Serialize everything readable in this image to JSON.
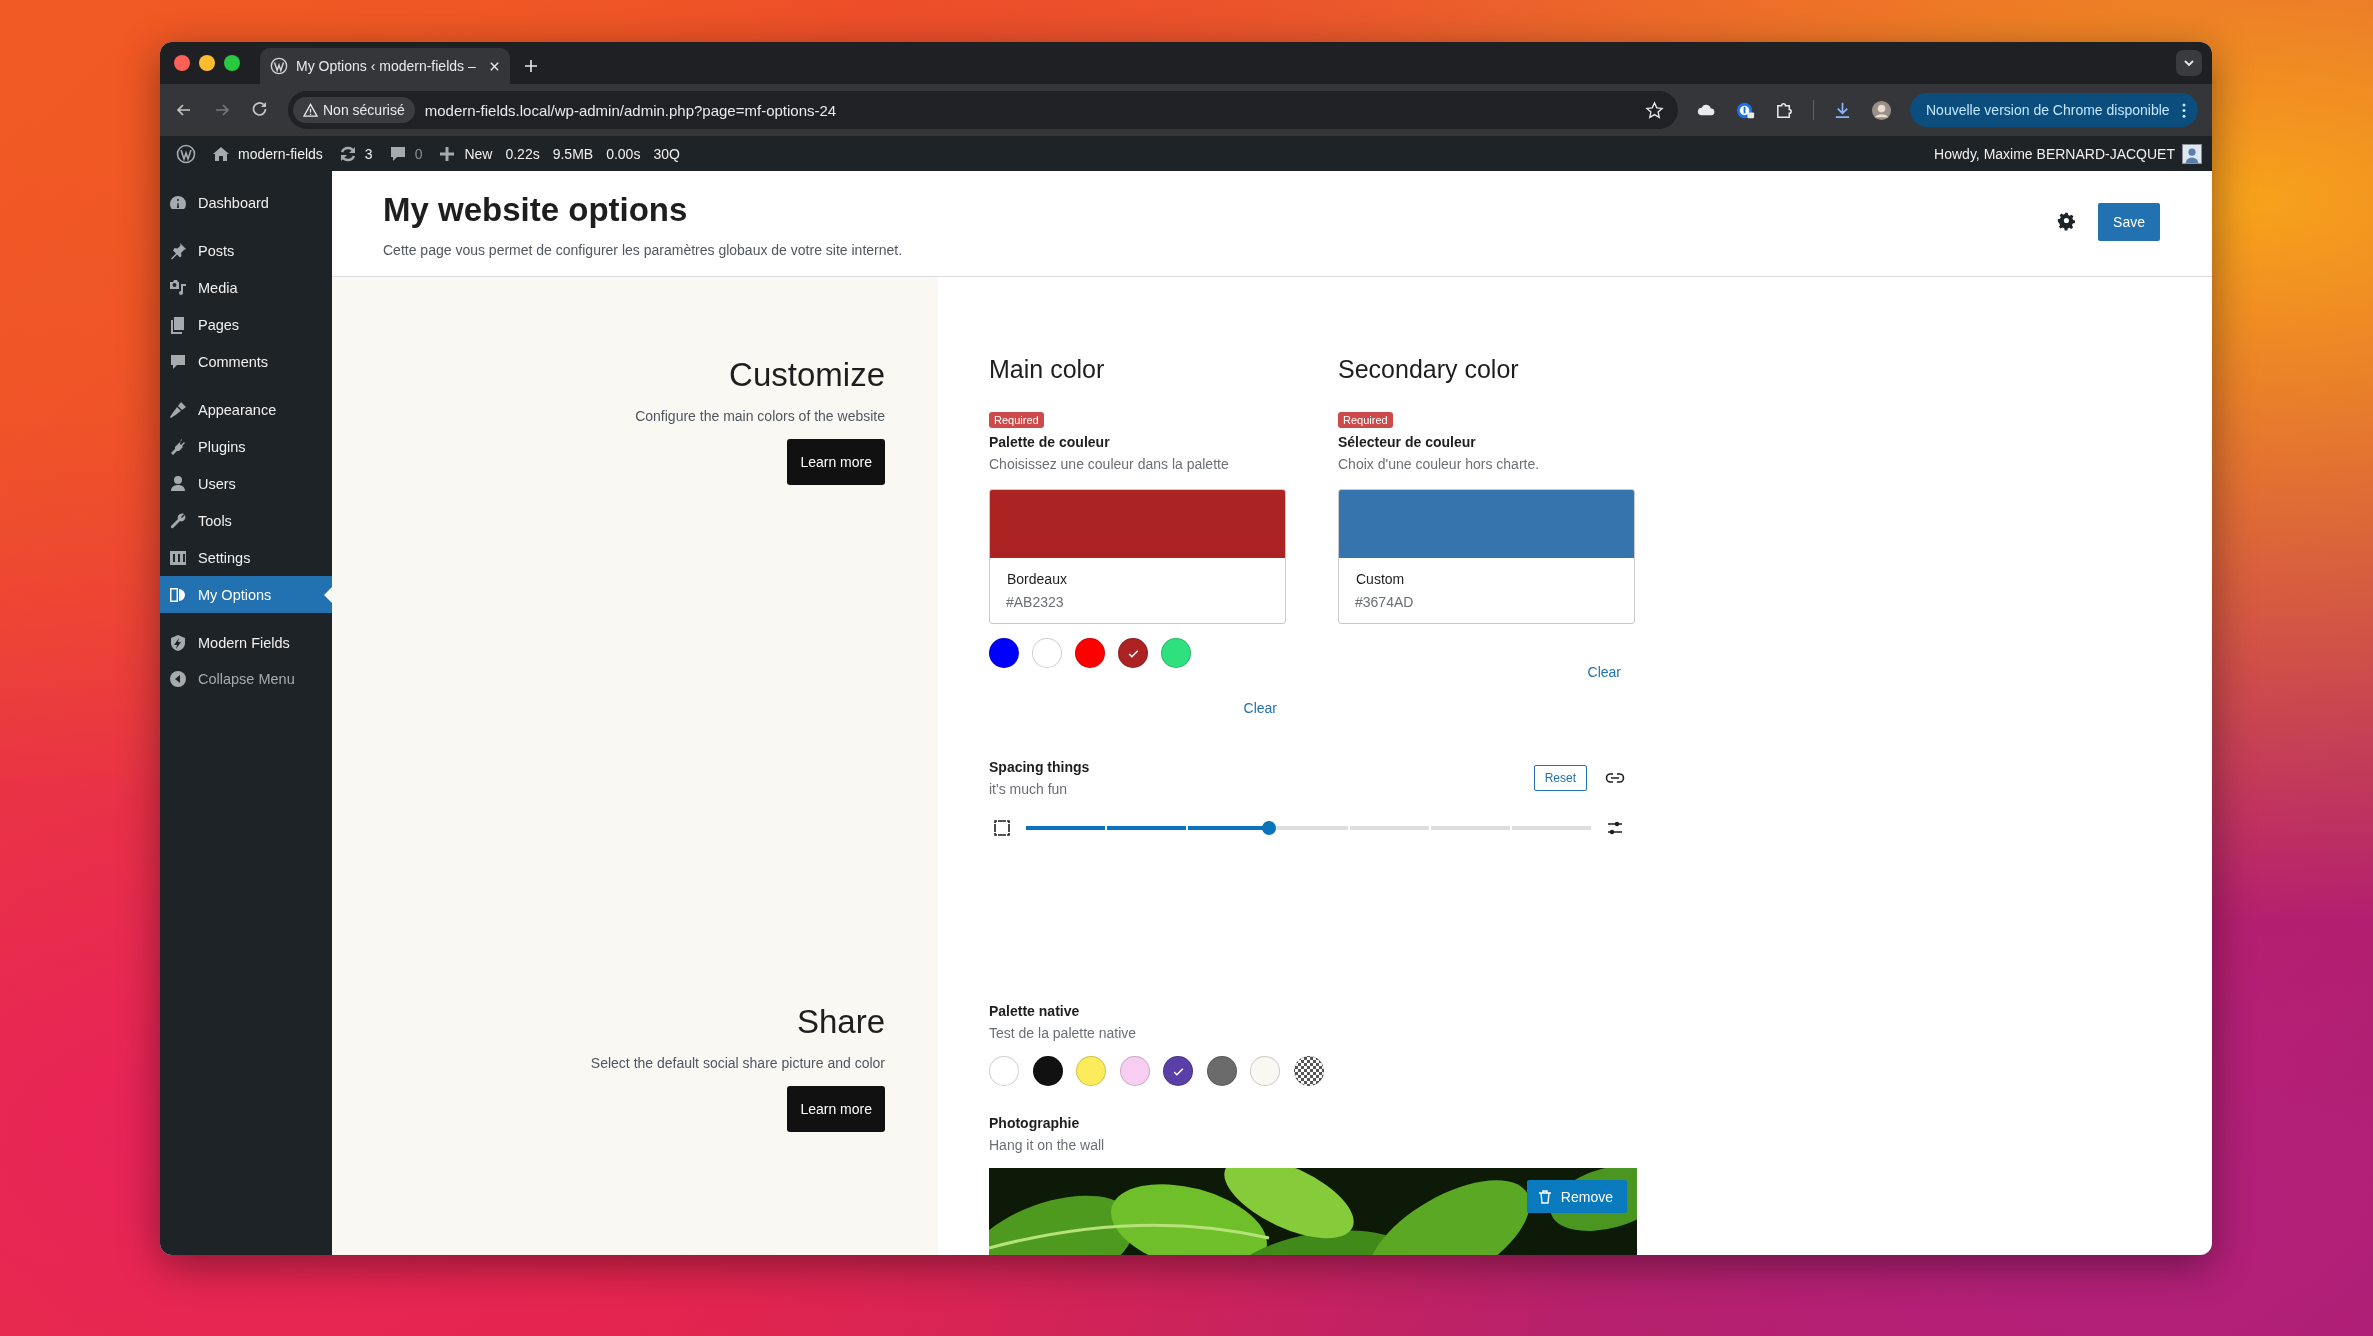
{
  "browser": {
    "tabs": [
      {
        "title": "My Options ‹ modern-fields –",
        "selected": true
      }
    ],
    "security_label": "Non sécurisé",
    "url": "modern-fields.local/wp-admin/admin.php?page=mf-options-24",
    "update_button": "Nouvelle version de Chrome disponible"
  },
  "admin_bar": {
    "site": "modern-fields",
    "updates": "3",
    "comments": "0",
    "new": "New",
    "stats": [
      "0.22s",
      "9.5MB",
      "0.00s",
      "30Q"
    ],
    "greeting": "Howdy, Maxime BERNARD-JACQUET"
  },
  "sidebar": {
    "groups": [
      [
        {
          "label": "Dashboard",
          "selected": false
        }
      ],
      [
        {
          "label": "Posts",
          "selected": false
        },
        {
          "label": "Media",
          "selected": false
        },
        {
          "label": "Pages",
          "selected": false
        },
        {
          "label": "Comments",
          "selected": false
        }
      ],
      [
        {
          "label": "Appearance",
          "selected": false
        },
        {
          "label": "Plugins",
          "selected": false
        },
        {
          "label": "Users",
          "selected": false
        },
        {
          "label": "Tools",
          "selected": false
        },
        {
          "label": "Settings",
          "selected": false
        },
        {
          "label": "My Options",
          "selected": true
        }
      ],
      [
        {
          "label": "Modern Fields",
          "selected": false
        }
      ]
    ],
    "collapse": "Collapse Menu"
  },
  "page": {
    "title": "My website options",
    "subtitle": "Cette page vous permet de configurer les paramètres globaux de votre site internet.",
    "save": "Save"
  },
  "sections": [
    {
      "title": "Customize",
      "description": "Configure the main colors of the website",
      "button": "Learn more"
    },
    {
      "title": "Share",
      "description": "Select the default social share picture and color",
      "button": "Learn more"
    }
  ],
  "color_fields": [
    {
      "heading": "Main color",
      "badge": "Required",
      "label": "Palette de couleur",
      "description": "Choisissez une couleur dans la palette",
      "color": "#ab2323",
      "color_name": "Bordeaux",
      "color_value": "#AB2323",
      "swatches": [
        {
          "color": "#0000ff",
          "selected": false
        },
        {
          "color": "#ffffff",
          "selected": false
        },
        {
          "color": "#ff0000",
          "selected": false
        },
        {
          "color": "#ab2323",
          "selected": true
        },
        {
          "color": "#2ee07e",
          "selected": false
        }
      ],
      "clear": "Clear"
    },
    {
      "heading": "Secondary color",
      "badge": "Required",
      "label": "Sélecteur de couleur",
      "description": "Choix d'une couleur hors charte.",
      "color": "#3674ad",
      "color_name": "Custom",
      "color_value": "#3674AD",
      "clear": "Clear"
    }
  ],
  "spacing": {
    "label": "Spacing things",
    "description": "it's much fun",
    "reset": "Reset",
    "level": 0.43
  },
  "native_palette": {
    "label": "Palette native",
    "description": "Test de la palette native",
    "swatches": [
      {
        "kind": "color",
        "color": "#ffffff",
        "selected": false
      },
      {
        "kind": "color",
        "color": "#111111",
        "selected": false
      },
      {
        "kind": "color",
        "color": "#fcec5c",
        "selected": false
      },
      {
        "kind": "color",
        "color": "#f7cdf1",
        "selected": false
      },
      {
        "kind": "color",
        "color": "#5b3fa8",
        "selected": true
      },
      {
        "kind": "color",
        "color": "#6b6b6b",
        "selected": false
      },
      {
        "kind": "color",
        "color": "#f9f8f3",
        "selected": false
      },
      {
        "kind": "transparent",
        "selected": false
      }
    ]
  },
  "photo": {
    "label": "Photographie",
    "description": "Hang it on the wall",
    "kind": "picture",
    "remove": "Remove"
  }
}
